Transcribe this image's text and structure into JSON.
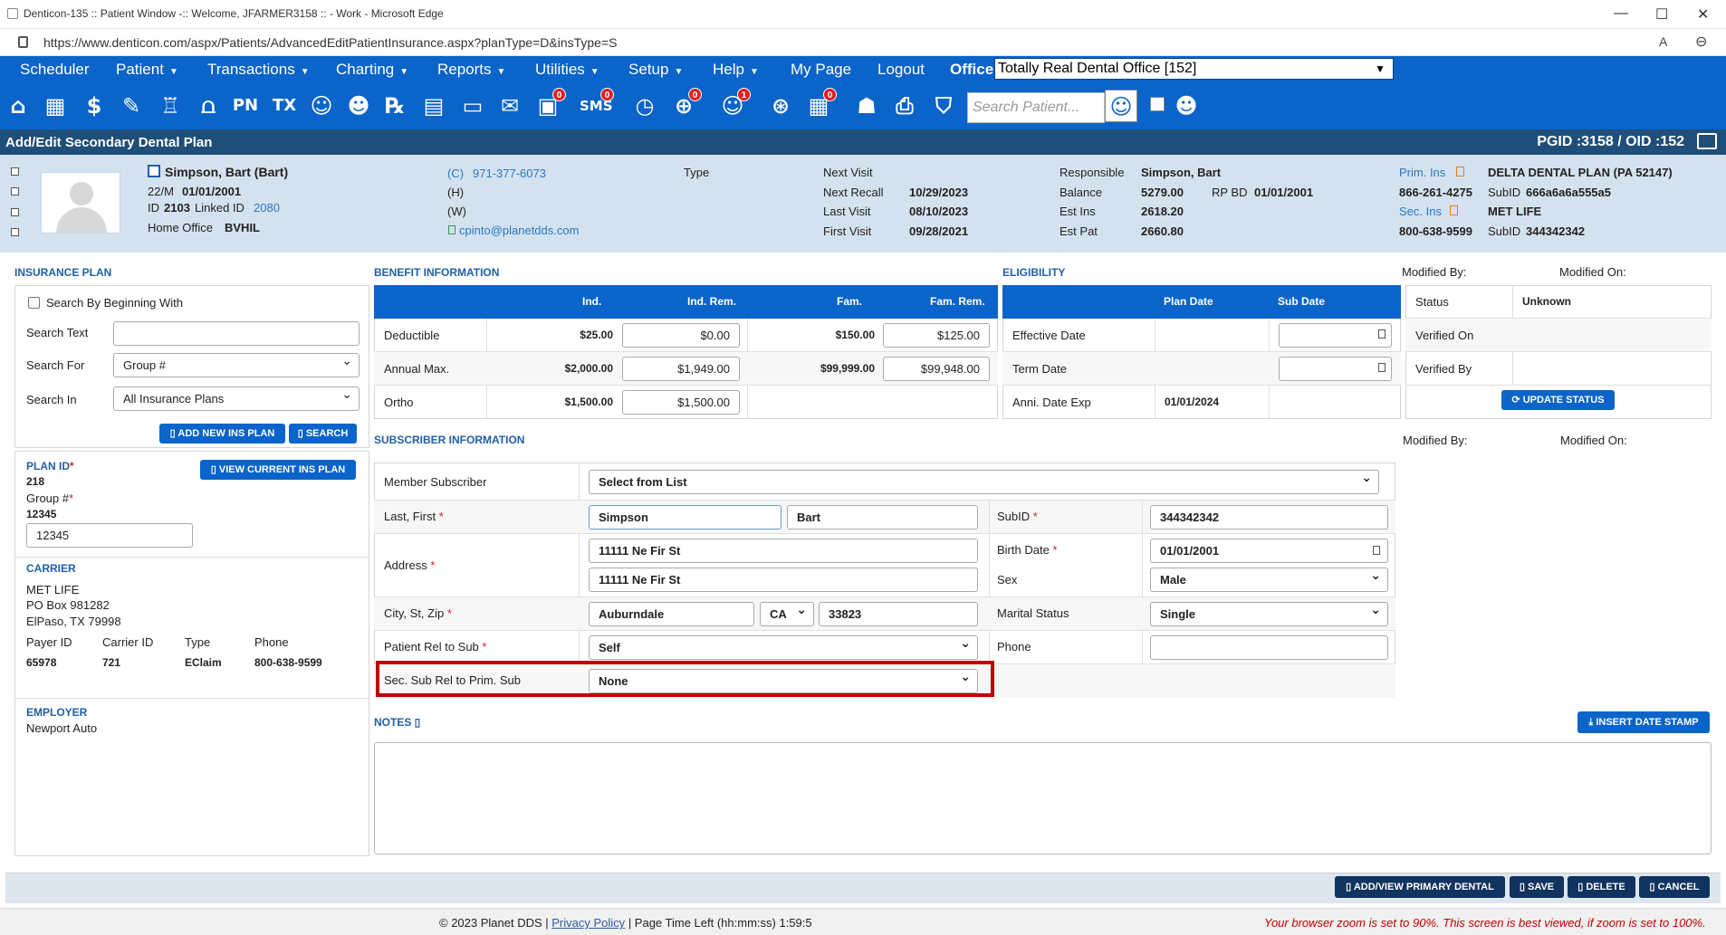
{
  "window": {
    "title": "Denticon-135 :: Patient Window -:: Welcome, JFARMER3158 :: - Work - Microsoft Edge",
    "url": "https://www.denticon.com/aspx/Patients/AdvancedEditPatientInsurance.aspx?planType=D&insType=S"
  },
  "menu": {
    "items": [
      "Scheduler",
      "Patient",
      "Transactions",
      "Charting",
      "Reports",
      "Utilities",
      "Setup",
      "Help",
      "My Page",
      "Logout"
    ],
    "office_label": "Office",
    "office_value": "Totally Real Dental Office [152]"
  },
  "toolbar": {
    "search_placeholder": "Search Patient...",
    "badges": {
      "b1": "0",
      "b2": "0",
      "sms": "0",
      "b3": "0",
      "b4": "1",
      "b5": "0"
    },
    "icons": [
      "home-icon",
      "calendar-icon",
      "dollar-icon",
      "chart-pen-icon",
      "tooth-icon",
      "teeth-icon",
      "PN",
      "TX",
      "add-user-icon",
      "add-group-icon",
      "Rx",
      "message-icon",
      "print-doc-icon",
      "envelope-icon",
      "chat-icon",
      "SMS",
      "clock-icon",
      "globe-icon",
      "smile-icon",
      "web-icon",
      "schedule-icon",
      "people-icon",
      "printer-icon",
      "shield-icon"
    ]
  },
  "header": {
    "title": "Add/Edit Secondary Dental Plan",
    "pgid": "PGID :3158  /  OID :152"
  },
  "patient": {
    "name": "Simpson, Bart (Bart)",
    "age_sex": "22/M",
    "dob": "01/01/2001",
    "id_label": "ID",
    "id": "2103",
    "linked_label": "Linked ID",
    "linked_id": "2080",
    "home_office_label": "Home Office",
    "home_office": "BVHIL",
    "phone_c_label": "(C)",
    "phone_c": "971-377-6073",
    "phone_h_label": "(H)",
    "phone_w_label": "(W)",
    "email": "cpinto@planetdds.com",
    "type_label": "Type",
    "next_visit_label": "Next Visit",
    "next_visit": "",
    "next_recall_label": "Next Recall",
    "next_recall": "10/29/2023",
    "last_visit_label": "Last Visit",
    "last_visit": "08/10/2023",
    "first_visit_label": "First Visit",
    "first_visit": "09/28/2021",
    "responsible_label": "Responsible",
    "responsible": "Simpson, Bart",
    "balance_label": "Balance",
    "balance": "5279.00",
    "rpbd_label": "RP BD",
    "rpbd": "01/01/2001",
    "est_ins_label": "Est Ins",
    "est_ins": "2618.20",
    "est_pat_label": "Est Pat",
    "est_pat": "2660.80",
    "prim_ins_label": "Prim. Ins",
    "prim_ins": "DELTA DENTAL PLAN (PA 52147)",
    "prim_phone": "866-261-4275",
    "prim_subid_label": "SubID",
    "prim_subid": "666a6a6a555a5",
    "sec_ins_label": "Sec. Ins",
    "sec_ins": "MET LIFE",
    "sec_phone": "800-638-9599",
    "sec_subid_label": "SubID",
    "sec_subid": "344342342"
  },
  "insurance_plan": {
    "title": "INSURANCE PLAN",
    "search_begin_label": "Search By Beginning With",
    "search_text_label": "Search Text",
    "search_text": "",
    "search_for_label": "Search For",
    "search_for": "Group #",
    "search_in_label": "Search In",
    "search_in": "All Insurance Plans",
    "add_new_btn": "ADD NEW INS PLAN",
    "search_btn": "SEARCH",
    "view_current_btn": "VIEW CURRENT INS PLAN",
    "plan_id_label": "PLAN ID",
    "plan_id": "218",
    "group_label": "Group #",
    "group": "12345",
    "group_input": "12345",
    "carrier_title": "CARRIER",
    "carrier_name": "MET LIFE",
    "carrier_addr1": "PO Box 981282",
    "carrier_addr2": "ElPaso, TX 79998",
    "payer_label": "Payer ID",
    "payer": "65978",
    "carrier_id_label": "Carrier ID",
    "carrier_id": "721",
    "type_label": "Type",
    "type": "EClaim",
    "phone_label": "Phone",
    "phone": "800-638-9599",
    "employer_title": "EMPLOYER",
    "employer": "Newport Auto"
  },
  "benefit": {
    "title": "BENEFIT INFORMATION",
    "cols": [
      "Ind.",
      "Ind. Rem.",
      "Fam.",
      "Fam. Rem."
    ],
    "rows": [
      {
        "label": "Deductible",
        "ind": "$25.00",
        "ind_rem": "$0.00",
        "fam": "$150.00",
        "fam_rem": "$125.00"
      },
      {
        "label": "Annual Max.",
        "ind": "$2,000.00",
        "ind_rem": "$1,949.00",
        "fam": "$99,999.00",
        "fam_rem": "$99,948.00"
      },
      {
        "label": "Ortho",
        "ind": "$1,500.00",
        "ind_rem": "$1,500.00",
        "fam": "",
        "fam_rem": ""
      }
    ]
  },
  "eligibility": {
    "title": "ELIGIBILITY",
    "cols": [
      "Plan Date",
      "Sub Date"
    ],
    "effective_label": "Effective Date",
    "term_label": "Term Date",
    "anni_label": "Anni. Date Exp",
    "anni": "01/01/2024",
    "modified_by_label": "Modified By:",
    "modified_on_label": "Modified On:",
    "status_label": "Status",
    "status": "Unknown",
    "verified_on_label": "Verified On",
    "verified_by_label": "Verified By",
    "update_btn": "UPDATE STATUS"
  },
  "subscriber": {
    "title": "SUBSCRIBER INFORMATION",
    "member_label": "Member Subscriber",
    "member": "Select from List",
    "last_first_label": "Last, First",
    "last": "Simpson",
    "first": "Bart",
    "address_label": "Address",
    "addr1": "11111 Ne Fir St",
    "addr2": "11111 Ne Fir St",
    "csz_label": "City, St, Zip",
    "city": "Auburndale",
    "state": "CA",
    "zip": "33823",
    "rel_label": "Patient Rel to Sub",
    "rel": "Self",
    "sec_rel_label": "Sec. Sub Rel to Prim. Sub",
    "sec_rel": "None",
    "subid_label": "SubID",
    "subid": "344342342",
    "birth_label": "Birth Date",
    "birth": "01/01/2001",
    "sex_label": "Sex",
    "sex": "Male",
    "marital_label": "Marital Status",
    "marital": "Single",
    "phone_label": "Phone",
    "phone": "",
    "modified_by_label": "Modified By:",
    "modified_on_label": "Modified On:"
  },
  "notes": {
    "title": "NOTES",
    "insert_btn": "INSERT DATE STAMP",
    "text": ""
  },
  "actions": {
    "add_view": "ADD/VIEW PRIMARY DENTAL",
    "save": "SAVE",
    "delete": "DELETE",
    "cancel": "CANCEL"
  },
  "footer": {
    "copyright": "© 2023 Planet DDS |",
    "privacy": "Privacy Policy",
    "page_time": "| Page Time Left (hh:mm:ss) 1:59:5",
    "zoom_msg": "Your browser zoom is set to 90%. This screen is best viewed, if zoom is set to 100%."
  }
}
